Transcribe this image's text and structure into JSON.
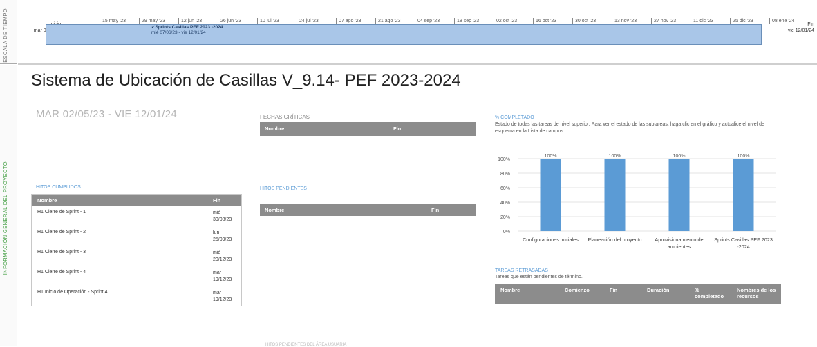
{
  "side": {
    "timescale_label": "ESCALA DE TIEMPO",
    "overview_label": "INFORMACIÓN GENERAL DEL PROYECTO"
  },
  "timeline": {
    "start_label": "Inicio",
    "start_date": "mar 02/05/23",
    "end_label": "Fin",
    "end_date": "vie 12/01/24",
    "ticks": [
      "15 may '23",
      "29 may '23",
      "12 jun '23",
      "26 jun '23",
      "10 jul '23",
      "24 jul '23",
      "07 ago '23",
      "21 ago '23",
      "04 sep '23",
      "18 sep '23",
      "02 oct '23",
      "16 oct '23",
      "30 oct '23",
      "13 nov '23",
      "27 nov '23",
      "11 dic '23",
      "25 dic '23",
      "08 ene '24"
    ],
    "task_name": "Sprints Casillas PEF 2023 -2024",
    "task_dates": "mié 07/06/23 - vie 12/01/24"
  },
  "report": {
    "title": "Sistema de Ubicación de Casillas V_9.14- PEF 2023-2024",
    "date_range": "MAR 02/05/23 - VIE 12/01/24"
  },
  "fechas_criticas": {
    "title": "FECHAS CRÍTICAS",
    "col_name": "Nombre",
    "col_end": "Fin"
  },
  "hitos_cumplidos": {
    "title": "HITOS CUMPLIDOS",
    "col_name": "Nombre",
    "col_end": "Fin",
    "rows": [
      {
        "name": "H1 Cierre de Sprint - 1",
        "day": "mié",
        "date": "30/08/23"
      },
      {
        "name": "H1 Cierre de Sprint - 2",
        "day": "lun",
        "date": "25/09/23"
      },
      {
        "name": "H1 Cierre de Sprint - 3",
        "day": "mié",
        "date": "20/12/23"
      },
      {
        "name": "H1 Cierre de Sprint - 4",
        "day": "mar",
        "date": "19/12/23"
      },
      {
        "name": "H1 Inicio de Operación - Sprint 4",
        "day": "mar",
        "date": "19/12/23"
      }
    ]
  },
  "hitos_pendientes": {
    "title": "HITOS PENDIENTES",
    "col_name": "Nombre",
    "col_end": "Fin"
  },
  "completado": {
    "title": "% COMPLETADO",
    "description": "Estado de todas las tareas de nivel superior. Para ver el estado de las subtareas, haga clic en el gráfico y actualice el nivel de esquema en la Lista de campos."
  },
  "chart_data": {
    "type": "bar",
    "categories": [
      [
        "Configuraciones iniciales"
      ],
      [
        "Planeación del proyecto"
      ],
      [
        "Aprovisionamiento de",
        "ambientes"
      ],
      [
        "Sprints Casillas PEF 2023",
        "-2024"
      ]
    ],
    "values": [
      100,
      100,
      100,
      100
    ],
    "data_labels": [
      "100%",
      "100%",
      "100%",
      "100%"
    ],
    "yticks": [
      "0%",
      "20%",
      "40%",
      "60%",
      "80%",
      "100%"
    ],
    "ylim": [
      0,
      100
    ],
    "bar_color": "#5b9bd5",
    "grid": true
  },
  "tareas_retrasadas": {
    "title": "TAREAS RETRASADAS",
    "description": "Tareas que están pendientes de término.",
    "columns": [
      "Nombre",
      "Comienzo",
      "Fin",
      "Duración",
      "% completado",
      "Nombres de los recursos"
    ]
  },
  "cut_off_text": "HITOS PENDIENTES DEL ÁREA USUARIA",
  "colors": {
    "accent": "#5b9bd5",
    "header_gray": "#8c8c8c",
    "timeline_bar": "#a9c6e8",
    "side_green": "#3a9a3a"
  }
}
